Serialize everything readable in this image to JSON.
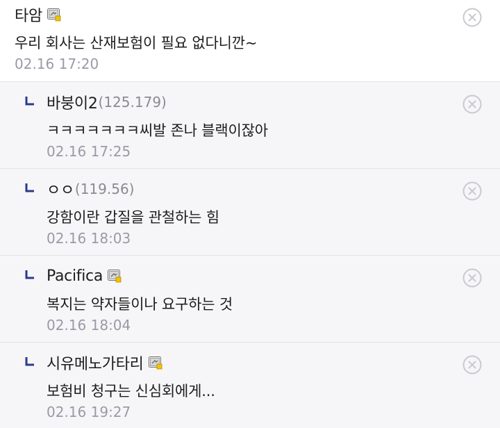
{
  "comments": [
    {
      "nick": "타암",
      "ip": "",
      "has_badge": true,
      "body": "우리 회사는 산재보험이 필요 없다니깐~",
      "time": "02.16 17:20"
    },
    {
      "nick": "바붕이2",
      "ip": "(125.179)",
      "has_badge": false,
      "body": "ㅋㅋㅋㅋㅋㅋㅋ씨발 존나 블랙이잖아",
      "time": "02.16 17:25"
    },
    {
      "nick": "ㅇㅇ",
      "ip": "(119.56)",
      "has_badge": false,
      "body": "강함이란 갑질을 관철하는 힘",
      "time": "02.16 18:03"
    },
    {
      "nick": "Pacifica",
      "ip": "",
      "has_badge": true,
      "body": "복지는 약자들이나 요구하는 것",
      "time": "02.16 18:04"
    },
    {
      "nick": "시유메노가타리",
      "ip": "",
      "has_badge": true,
      "body": "보험비 청구는 신심회에게...",
      "time": "02.16 19:27"
    }
  ],
  "icons": {
    "delete": "circle-x-icon",
    "reply": "reply-arrow-icon",
    "badge": "fixed-nick-badge-icon"
  },
  "colors": {
    "reply_bg": "#f6f6f8",
    "timestamp": "#9a9aa6",
    "reply_arrow": "#2b3a8c",
    "badge_accent": "#f5c400"
  }
}
